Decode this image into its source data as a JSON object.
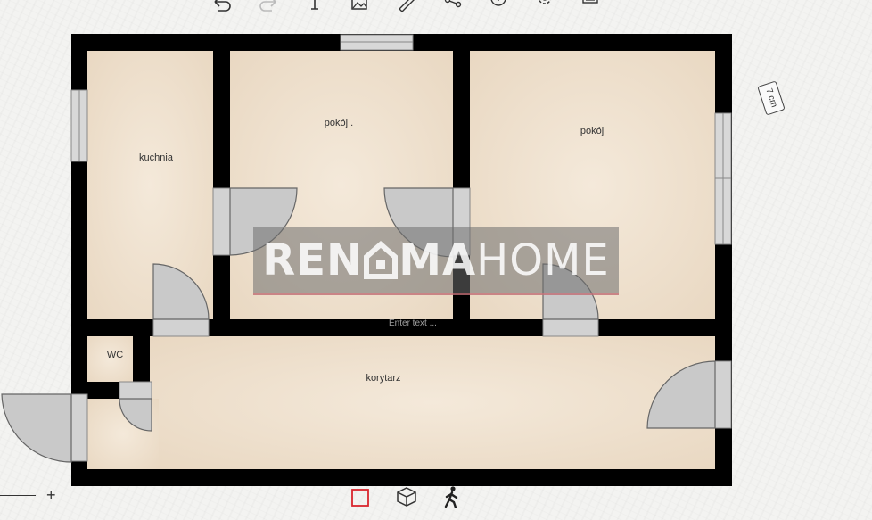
{
  "toolbar": {
    "icons": [
      "undo-icon",
      "redo-icon",
      "text-tool-icon",
      "image-icon",
      "ruler-icon",
      "share-icon",
      "help-icon",
      "settings-icon",
      "print-icon"
    ]
  },
  "plan": {
    "rooms": {
      "kuchnia": "kuchnia",
      "pokoj_left": "pokój .",
      "pokoj_right": "pokój",
      "wc": "WC",
      "korytarz": "korytarz"
    },
    "enter_text_placeholder": "Enter text ...",
    "scale_badge": "7 cm"
  },
  "watermark": {
    "part1": "REN",
    "part2": "MA",
    "part3": "HOME"
  },
  "bottom": {
    "icons": [
      "2d-view-icon",
      "3d-view-icon",
      "walk-mode-icon"
    ],
    "zoom_plus": "+"
  },
  "colors": {
    "wall": "#000000",
    "floor": "#f1e4d3",
    "door": "#c8c8c8",
    "accent": "#d9262e"
  }
}
